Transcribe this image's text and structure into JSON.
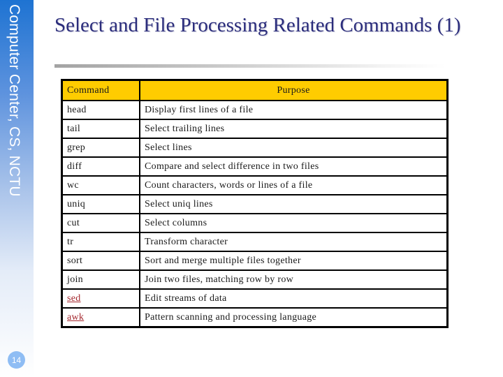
{
  "sidebar": {
    "label": "Computer Center, CS, NCTU",
    "page_number": "14"
  },
  "slide": {
    "title": "Select and File Processing Related Commands (1)"
  },
  "table": {
    "headers": [
      "Command",
      "Purpose"
    ],
    "rows": [
      {
        "command": "head",
        "purpose": "Display first lines of a file",
        "is_link": false
      },
      {
        "command": "tail",
        "purpose": "Select trailing lines",
        "is_link": false
      },
      {
        "command": "grep",
        "purpose": "Select lines",
        "is_link": false
      },
      {
        "command": "diff",
        "purpose": "Compare and select difference in two files",
        "is_link": false
      },
      {
        "command": "wc",
        "purpose": "Count characters, words or lines of a file",
        "is_link": false
      },
      {
        "command": "uniq",
        "purpose": "Select uniq lines",
        "is_link": false
      },
      {
        "command": "cut",
        "purpose": "Select columns",
        "is_link": false
      },
      {
        "command": "tr",
        "purpose": "Transform character",
        "is_link": false
      },
      {
        "command": "sort",
        "purpose": "Sort and merge multiple files together",
        "is_link": false
      },
      {
        "command": "join",
        "purpose": "Join two files, matching row by row",
        "is_link": false
      },
      {
        "command": "sed",
        "purpose": "Edit streams of data",
        "is_link": true
      },
      {
        "command": "awk",
        "purpose": "Pattern scanning and processing language",
        "is_link": true
      }
    ]
  },
  "colors": {
    "header_fill": "#ffcc00",
    "title": "#2b2d7c",
    "link": "#a4262c",
    "sidebar_top": "#1e73d2"
  }
}
